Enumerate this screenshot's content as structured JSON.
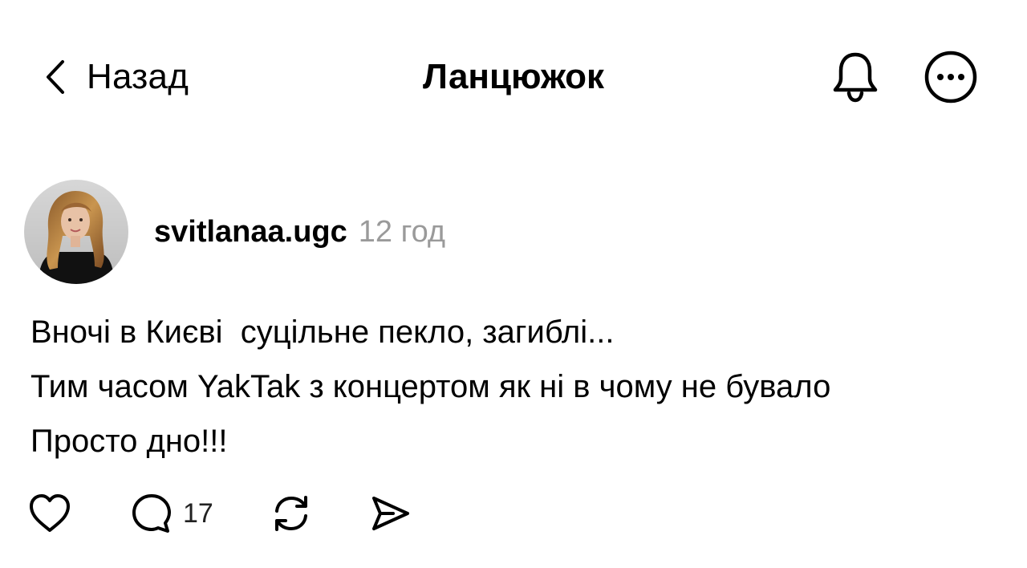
{
  "header": {
    "back_label": "Назад",
    "title": "Ланцюжок",
    "icons": [
      "chevron-left-icon",
      "bell-icon",
      "more-icon"
    ]
  },
  "post": {
    "author": "svitlanaa.ugc",
    "time": "12 год",
    "lines": [
      "Вночі в Києві  суцільне пекло, загиблі...",
      "Тим часом YakTak з концертом як ні в чому не бувало",
      "Просто дно!!!"
    ],
    "comment_count": "17",
    "action_icons": [
      "heart-icon",
      "comment-icon",
      "repost-icon",
      "share-icon"
    ]
  },
  "colors": {
    "text": "#000000",
    "muted": "#9a9a9a",
    "background": "#ffffff"
  }
}
